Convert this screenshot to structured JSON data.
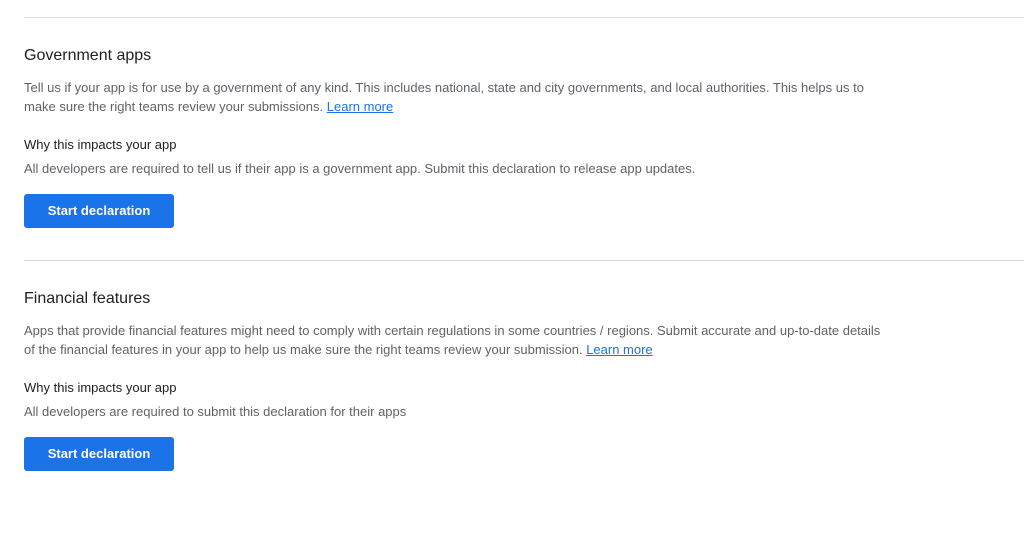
{
  "government": {
    "title": "Government apps",
    "description": "Tell us if your app is for use by a government of any kind. This includes national, state and city governments, and local authorities. This helps us to make sure the right teams review your submissions.",
    "learn_more": "Learn more",
    "why_title": "Why this impacts your app",
    "why_text": "All developers are required to tell us if their app is a government app. Submit this declaration to release app updates.",
    "button_label": "Start declaration"
  },
  "financial": {
    "title": "Financial features",
    "description": "Apps that provide financial features might need to comply with certain regulations in some countries / regions. Submit accurate and up-to-date details of the financial features in your app to help us make sure the right teams review your submission.",
    "learn_more": "Learn more",
    "why_title": "Why this impacts your app",
    "why_text": "All developers are required to submit this declaration for their apps",
    "button_label": "Start declaration"
  },
  "colors": {
    "primary": "#1a73e8",
    "link": "#1a73e8",
    "divider": "#dadce0",
    "body_text": "#5f6368",
    "heading_text": "#202124"
  }
}
